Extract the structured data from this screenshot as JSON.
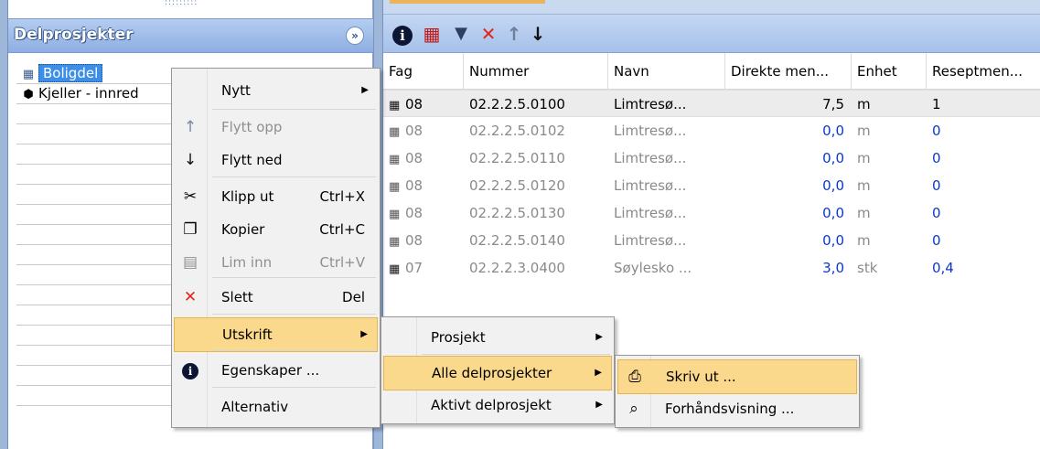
{
  "left_panel": {
    "title": "Delprosjekter",
    "collapse_icon": "double-chevron-down-icon",
    "tree_items": [
      {
        "label": "Boligdel",
        "icon": "house-icon",
        "selected": true
      },
      {
        "label": "Kjeller - innred",
        "icon": "cube-icon",
        "selected": false
      }
    ]
  },
  "toolbar": {
    "icons": [
      "info-icon",
      "grid-icon",
      "tool-icon",
      "delete-icon",
      "arrow-up-icon",
      "arrow-down-icon"
    ]
  },
  "grid": {
    "columns": [
      "Fag",
      "Nummer",
      "Navn",
      "Direkte men...",
      "Enhet",
      "Reseptmen..."
    ],
    "rows": [
      {
        "fag": "08",
        "nummer": "02.2.2.5.0100",
        "navn": "Limtresø...",
        "direkte": "7,5",
        "enhet": "m",
        "resept": "1"
      },
      {
        "fag": "08",
        "nummer": "02.2.2.5.0102",
        "navn": "Limtresø...",
        "direkte": "0,0",
        "enhet": "m",
        "resept": "0"
      },
      {
        "fag": "08",
        "nummer": "02.2.2.5.0110",
        "navn": "Limtresø...",
        "direkte": "0,0",
        "enhet": "m",
        "resept": "0"
      },
      {
        "fag": "08",
        "nummer": "02.2.2.5.0120",
        "navn": "Limtresø...",
        "direkte": "0,0",
        "enhet": "m",
        "resept": "0"
      },
      {
        "fag": "08",
        "nummer": "02.2.2.5.0130",
        "navn": "Limtresø...",
        "direkte": "0,0",
        "enhet": "m",
        "resept": "0"
      },
      {
        "fag": "08",
        "nummer": "02.2.2.5.0140",
        "navn": "Limtresø...",
        "direkte": "0,0",
        "enhet": "m",
        "resept": "0"
      },
      {
        "fag": "07",
        "nummer": "02.2.2.3.0400",
        "navn": "Søylesko ...",
        "direkte": "3,0",
        "enhet": "stk",
        "resept": "0,4"
      }
    ]
  },
  "context_menu": {
    "items": [
      {
        "label": "Nytt",
        "shortcut": "",
        "submenu": true,
        "disabled": false,
        "icon": ""
      },
      {
        "label": "Flytt opp",
        "shortcut": "",
        "submenu": false,
        "disabled": true,
        "icon": "arrow-up-icon"
      },
      {
        "label": "Flytt ned",
        "shortcut": "",
        "submenu": false,
        "disabled": false,
        "icon": "arrow-down-icon"
      },
      {
        "label": "Klipp ut",
        "shortcut": "Ctrl+X",
        "submenu": false,
        "disabled": false,
        "icon": "scissors-icon"
      },
      {
        "label": "Kopier",
        "shortcut": "Ctrl+C",
        "submenu": false,
        "disabled": false,
        "icon": "copy-icon"
      },
      {
        "label": "Lim inn",
        "shortcut": "Ctrl+V",
        "submenu": false,
        "disabled": true,
        "icon": "paste-icon"
      },
      {
        "label": "Slett",
        "shortcut": "Del",
        "submenu": false,
        "disabled": false,
        "icon": "delete-icon"
      },
      {
        "label": "Utskrift",
        "shortcut": "",
        "submenu": true,
        "disabled": false,
        "icon": "",
        "active": true
      },
      {
        "label": "Egenskaper ...",
        "shortcut": "",
        "submenu": false,
        "disabled": false,
        "icon": "info-icon"
      },
      {
        "label": "Alternativ",
        "shortcut": "",
        "submenu": false,
        "disabled": false,
        "icon": ""
      }
    ]
  },
  "submenu_utskrift": {
    "items": [
      {
        "label": "Prosjekt",
        "submenu": true
      },
      {
        "label": "Alle delprosjekter",
        "submenu": true,
        "active": true
      },
      {
        "label": "Aktivt delprosjekt",
        "submenu": true
      }
    ]
  },
  "submenu_alle": {
    "items": [
      {
        "label": "Skriv ut ...",
        "icon": "printer-icon",
        "active": true
      },
      {
        "label": "Forhåndsvisning ...",
        "icon": "print-preview-icon"
      }
    ]
  },
  "colors": {
    "panel_header": "#9eb7d8",
    "selection_blue": "#3c8ee7",
    "menu_highlight": "#fad88c",
    "value_blue": "#0b38c9"
  }
}
